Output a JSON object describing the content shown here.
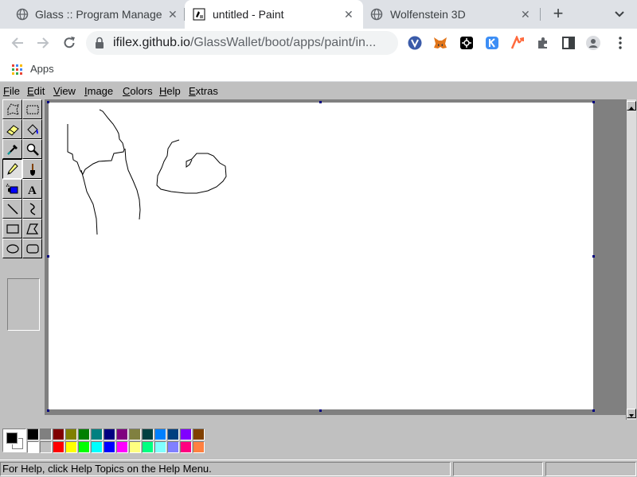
{
  "browser": {
    "tabs": [
      {
        "title": "Glass :: Program Manager",
        "icon": "chrome-globe-icon",
        "active": false
      },
      {
        "title": "untitled - Paint",
        "icon": "paint-app-icon",
        "active": true
      },
      {
        "title": "Wolfenstein 3D",
        "icon": "chrome-globe-icon",
        "active": false
      }
    ],
    "close_glyph": "✕",
    "new_tab_glyph": "+",
    "url_host": "ifilex.github.io",
    "url_path": "/GlassWallet/boot/apps/paint/in...",
    "bookmarks": {
      "apps_label": "Apps"
    },
    "extensions": [
      "vivaldi-v-icon",
      "metamask-fox-icon",
      "black-square-extension-icon",
      "k-extension-icon",
      "orange-extension-icon",
      "puzzle-extensions-icon",
      "side-panel-icon",
      "profile-avatar-icon",
      "kebab-menu-icon"
    ]
  },
  "paint": {
    "menu": [
      {
        "accel": "F",
        "rest": "ile"
      },
      {
        "accel": "E",
        "rest": "dit"
      },
      {
        "accel": "V",
        "rest": "iew"
      },
      {
        "accel": "I",
        "rest": "mage"
      },
      {
        "accel": "C",
        "rest": "olors"
      },
      {
        "accel": "H",
        "rest": "elp"
      },
      {
        "accel": "E",
        "rest": "xtras"
      }
    ],
    "tools": [
      "free-select",
      "rect-select",
      "eraser",
      "fill",
      "pick-color",
      "magnifier",
      "pencil",
      "brush",
      "airbrush",
      "text",
      "line",
      "curve",
      "rectangle",
      "polygon",
      "ellipse",
      "rounded-rectangle"
    ],
    "active_tool": "pencil",
    "primary_color": "#000000",
    "secondary_color": "#ffffff",
    "palette": {
      "row1": [
        "#000000",
        "#808080",
        "#800000",
        "#808000",
        "#008000",
        "#008080",
        "#000080",
        "#800080",
        "#808040",
        "#004040",
        "#0080ff",
        "#004080",
        "#8000ff",
        "#804000"
      ],
      "row2": [
        "#ffffff",
        "#c0c0c0",
        "#ff0000",
        "#ffff00",
        "#00ff00",
        "#00ffff",
        "#0000ff",
        "#ff00ff",
        "#ffff80",
        "#00ff80",
        "#80ffff",
        "#8080ff",
        "#ff0080",
        "#ff8040"
      ]
    },
    "status_text": "For Help, click Help Topics on the Help Menu."
  }
}
